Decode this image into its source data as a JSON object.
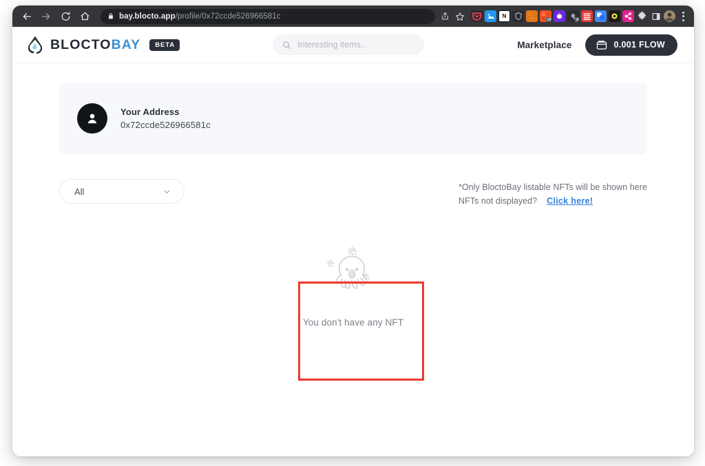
{
  "browser": {
    "nav": {
      "back": "back-arrow",
      "forward": "forward-arrow",
      "reload": "reload",
      "home": "home"
    },
    "omnibox": {
      "lock_icon": "lock-icon",
      "host": "bay.blocto.app",
      "path": "/profile/0x72ccde526966581c",
      "share_icon": "share-icon",
      "bookmark_icon": "star-icon"
    },
    "extensions": [
      {
        "name": "pocket-extension",
        "color": "#ef4056",
        "glyph": ""
      },
      {
        "name": "screenshot-extension",
        "color": "#2196f3",
        "glyph": ""
      },
      {
        "name": "notion-extension",
        "color": "#ffffff",
        "glyph": "N"
      },
      {
        "name": "shield-extension",
        "color": "#8b8f98",
        "glyph": ""
      },
      {
        "name": "metamask-extension",
        "color": "#e2761b",
        "glyph": ""
      },
      {
        "name": "adblock-off-extension",
        "color": "#f4511e",
        "glyph": "",
        "badge": "off"
      },
      {
        "name": "blocto-wallet-extension",
        "color": "#6c2bd9",
        "glyph": ""
      },
      {
        "name": "grammarly-extension",
        "color": "#9aa0a6",
        "glyph": "",
        "badge": "A"
      },
      {
        "name": "honey-extension",
        "color": "#e53935",
        "glyph": ""
      },
      {
        "name": "translate-extension",
        "color": "#4285f4",
        "glyph": ""
      },
      {
        "name": "phantom-extension",
        "color": "#1a1a1a",
        "glyph": ""
      },
      {
        "name": "share-extension",
        "color": "#e91e8c",
        "glyph": ""
      },
      {
        "name": "puzzle-extensions-button",
        "color": "#dadce0",
        "glyph": ""
      },
      {
        "name": "side-panel-button",
        "color": "#dadce0",
        "glyph": ""
      },
      {
        "name": "profile-avatar-button",
        "color": "#7a6a58",
        "glyph": ""
      }
    ],
    "menu_icon": "three-dots-menu"
  },
  "header": {
    "brand": {
      "logo_icon": "blocto-droplet-logo",
      "word_dark": "BLOCTO",
      "word_accent": "BAY",
      "badge": "BETA",
      "accent_color": "#3f8fd0"
    },
    "search": {
      "icon": "search-icon",
      "placeholder": "Interesting items..",
      "value": ""
    },
    "marketplace_label": "Marketplace",
    "wallet": {
      "icon": "wallet-icon",
      "balance": "0.001 FLOW"
    }
  },
  "profile": {
    "avatar_icon": "person-icon",
    "address_label": "Your Address",
    "address_value": "0x72ccde526966581c"
  },
  "controls": {
    "filter": {
      "selected": "All",
      "chevron_icon": "chevron-down-icon",
      "options": [
        "All"
      ]
    },
    "notes": {
      "line1": "*Only BloctoBay listable NFTs will be shown here",
      "line2": "NFTs not displayed?",
      "link": "Click here!",
      "link_color": "#2f80d8"
    }
  },
  "empty_state": {
    "illustration": "octopus-sparkles-illustration",
    "message": "You don't have any NFT"
  },
  "annotation": {
    "label": "red-highlight-box",
    "color": "#f0382c"
  }
}
